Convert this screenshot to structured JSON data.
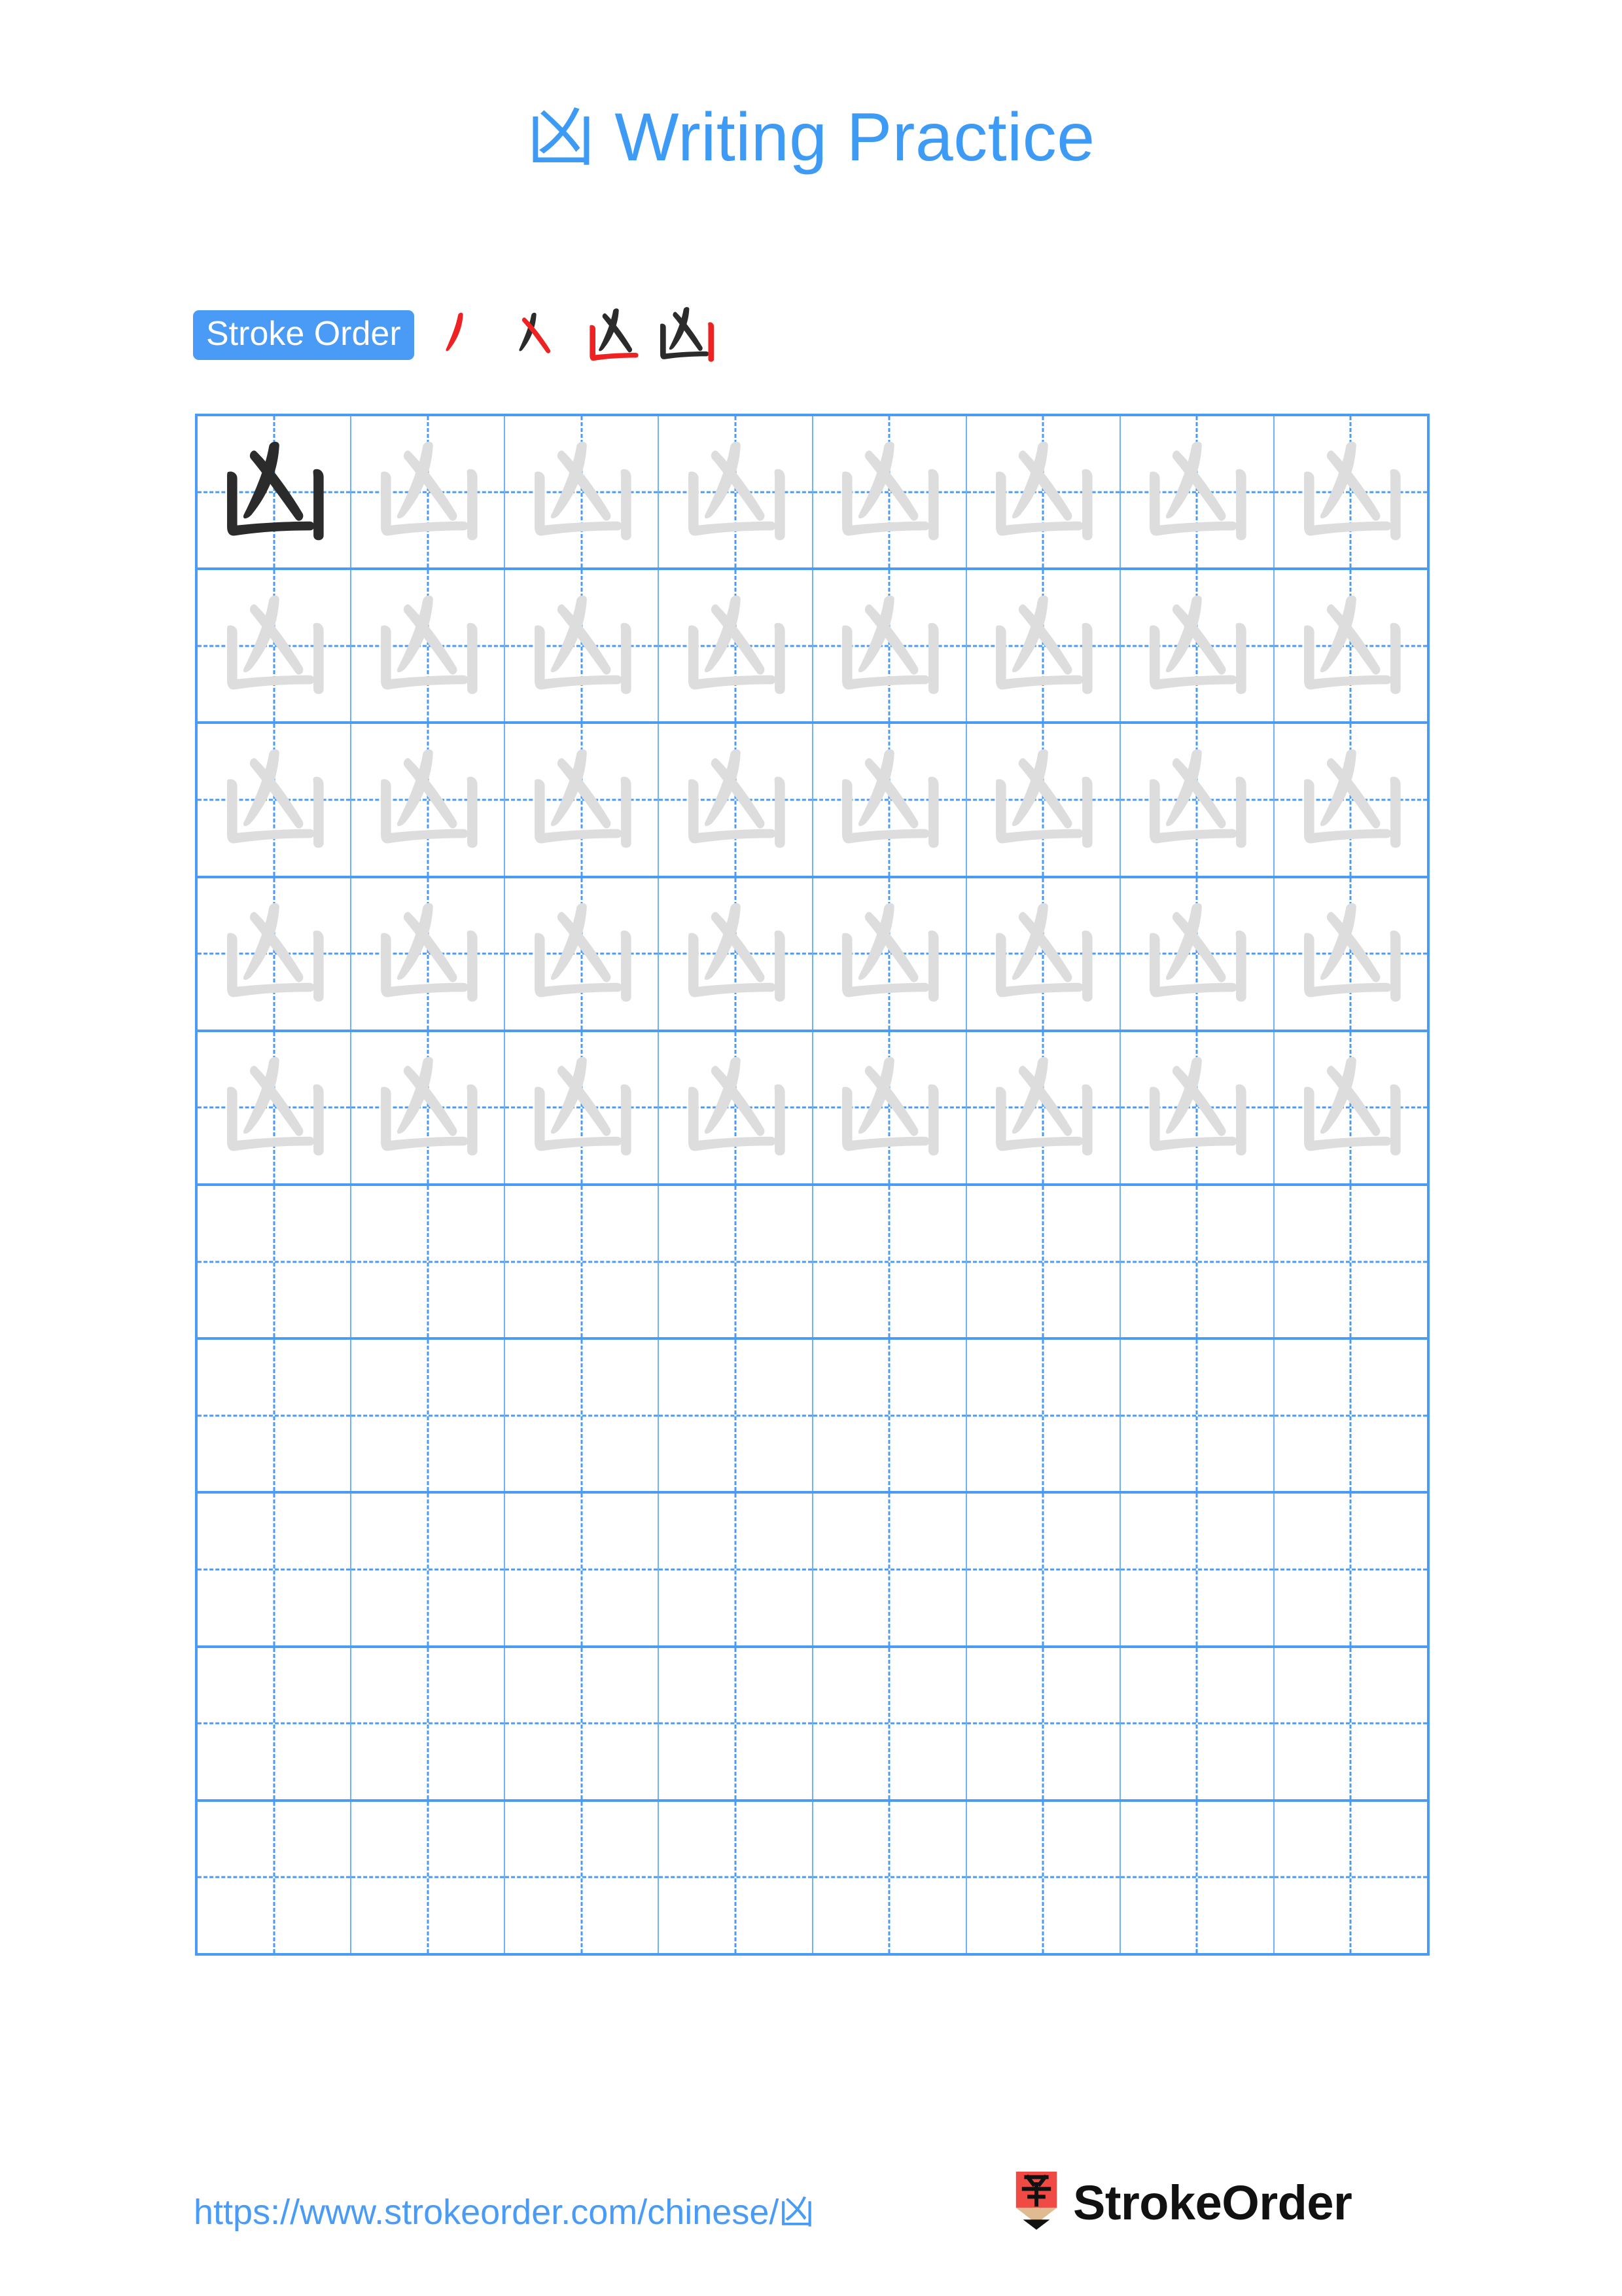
{
  "page": {
    "character": "凶",
    "title_suffix": " Writing Practice",
    "title_full": "凶 Writing Practice",
    "background_color": "#ffffff",
    "accent_color": "#4a9bf5",
    "title_color": "#3d9bf5",
    "trace_color": "#dddddd",
    "ink_color": "#2b2b2b",
    "highlight_stroke_color": "#ee2222"
  },
  "stroke_order": {
    "badge_label": "Stroke Order",
    "badge_background": "#4a9bf5",
    "badge_text_color": "#ffffff",
    "stroke_count": 4,
    "steps": [
      {
        "index": 1,
        "name": "stroke-step-1",
        "strokes_shown": 1,
        "new_stroke": "丿",
        "new_stroke_color": "#ee2222"
      },
      {
        "index": 2,
        "name": "stroke-step-2",
        "strokes_shown": 2,
        "new_stroke": "乂",
        "new_stroke_color": "#ee2222"
      },
      {
        "index": 3,
        "name": "stroke-step-3",
        "strokes_shown": 3,
        "new_stroke": "凵-left",
        "new_stroke_color": "#ee2222"
      },
      {
        "index": 4,
        "name": "stroke-step-4",
        "strokes_shown": 4,
        "new_stroke": "凵-right",
        "new_stroke_color": "#ee2222"
      }
    ]
  },
  "practice_grid": {
    "columns": 8,
    "rows": 10,
    "filled_rows": 5,
    "empty_rows": 5,
    "total_cells": 80,
    "dark_model_cells": 1,
    "trace_cells": 39,
    "blank_cells": 40,
    "grid_line_color": "#4a9bf5",
    "column_line_color": "#6fb2f7",
    "guide_line_style": "dashed",
    "row_fill": [
      [
        "dark",
        "trace",
        "trace",
        "trace",
        "trace",
        "trace",
        "trace",
        "trace"
      ],
      [
        "trace",
        "trace",
        "trace",
        "trace",
        "trace",
        "trace",
        "trace",
        "trace"
      ],
      [
        "trace",
        "trace",
        "trace",
        "trace",
        "trace",
        "trace",
        "trace",
        "trace"
      ],
      [
        "trace",
        "trace",
        "trace",
        "trace",
        "trace",
        "trace",
        "trace",
        "trace"
      ],
      [
        "trace",
        "trace",
        "trace",
        "trace",
        "trace",
        "trace",
        "trace",
        "trace"
      ],
      [
        "blank",
        "blank",
        "blank",
        "blank",
        "blank",
        "blank",
        "blank",
        "blank"
      ],
      [
        "blank",
        "blank",
        "blank",
        "blank",
        "blank",
        "blank",
        "blank",
        "blank"
      ],
      [
        "blank",
        "blank",
        "blank",
        "blank",
        "blank",
        "blank",
        "blank",
        "blank"
      ],
      [
        "blank",
        "blank",
        "blank",
        "blank",
        "blank",
        "blank",
        "blank",
        "blank"
      ],
      [
        "blank",
        "blank",
        "blank",
        "blank",
        "blank",
        "blank",
        "blank",
        "blank"
      ]
    ]
  },
  "footer": {
    "url": "https://www.strokeorder.com/chinese/凶",
    "url_color": "#4a9bf5",
    "brand_name": "StrokeOrder",
    "brand_color": "#111111",
    "logo_icon": "pencil-zi-icon",
    "logo_body_color": "#ef4a44",
    "logo_wood_color": "#e0bb91",
    "logo_tip_color": "#111111",
    "logo_char": "字"
  }
}
